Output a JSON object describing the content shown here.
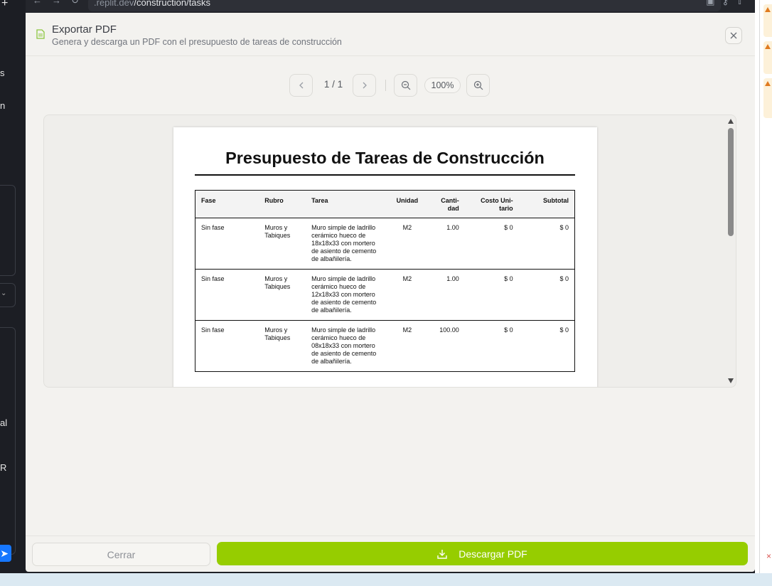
{
  "background_app": {
    "left_fragments": [
      "s",
      "n",
      "al",
      "R"
    ],
    "send_icon": "send-icon",
    "right_warning_icons": [
      "warning-icon",
      "warning-icon",
      "warning-icon"
    ],
    "right_close_glyph": "×"
  },
  "browser": {
    "nav_icons": [
      "back-icon",
      "forward-icon",
      "reload-icon"
    ],
    "url_prefix": ".replit.dev",
    "url_path": "/construction/tasks"
  },
  "modal": {
    "title": "Exportar PDF",
    "subtitle": "Genera y descarga un PDF con el presupuesto de tareas de construcción",
    "toolbar": {
      "page_indicator": "1 / 1",
      "zoom_label": "100%"
    },
    "footer": {
      "close_label": "Cerrar",
      "download_label": "Descargar PDF"
    },
    "colors": {
      "accent": "#96cd00",
      "doc_icon": "#8cc63f"
    }
  },
  "pdf": {
    "title": "Presupuesto de Tareas de Construcción",
    "columns": [
      "Fase",
      "Rubro",
      "Tarea",
      "Unidad",
      "Canti-\ndad",
      "Costo Uni-\ntario",
      "Subtotal"
    ],
    "rows": [
      {
        "fase": "Sin fase",
        "rubro": "Muros y Tabiques",
        "tarea": "Muro simple de ladrillo cerámico hueco de 18x18x33 con mortero de asiento de cemento de albañilería.",
        "unidad": "M2",
        "cantidad": "1.00",
        "costo": "$ 0",
        "subtotal": "$ 0"
      },
      {
        "fase": "Sin fase",
        "rubro": "Muros y Tabiques",
        "tarea": "Muro simple de ladrillo cerámico hueco de 12x18x33 con mortero de asiento de cemento de albañilería.",
        "unidad": "M2",
        "cantidad": "1.00",
        "costo": "$ 0",
        "subtotal": "$ 0"
      },
      {
        "fase": "Sin fase",
        "rubro": "Muros y Tabiques",
        "tarea": "Muro simple de ladrillo cerámico hueco de 08x18x33 con mortero de asiento de cemento de albañilería.",
        "unidad": "M2",
        "cantidad": "100.00",
        "costo": "$ 0",
        "subtotal": "$ 0"
      }
    ]
  }
}
